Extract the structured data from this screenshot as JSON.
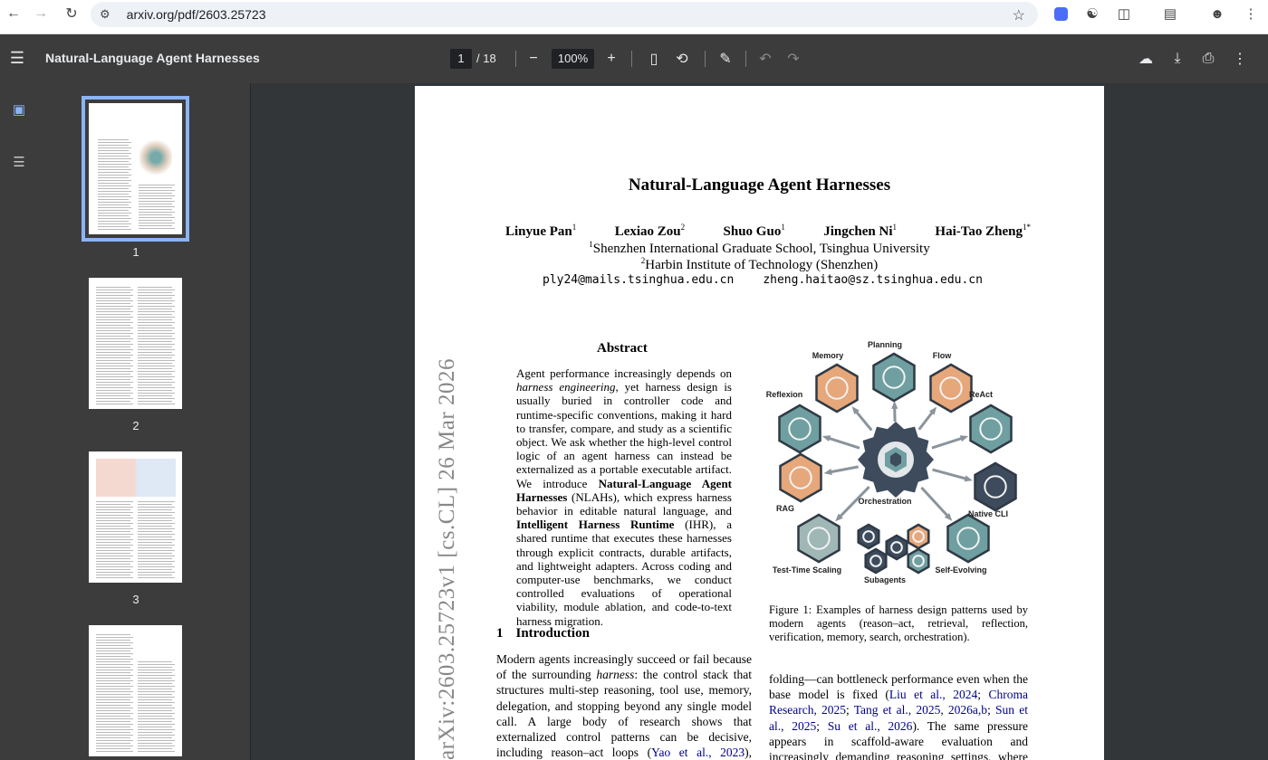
{
  "browser": {
    "url": "arxiv.org/pdf/2603.25723"
  },
  "toolbar": {
    "doc_title": "Natural-Language Agent Harnesses",
    "current_page": "1",
    "page_total": "/ 18",
    "zoom": "100%"
  },
  "sidebar": {
    "thumbnails": [
      {
        "label": "1"
      },
      {
        "label": "2"
      },
      {
        "label": "3"
      },
      {
        "label": ""
      }
    ]
  },
  "paper": {
    "title": "Natural-Language Agent Harnesses",
    "authors": [
      {
        "name": "Linyue Pan",
        "sup": "1"
      },
      {
        "name": "Lexiao Zou",
        "sup": "2"
      },
      {
        "name": "Shuo Guo",
        "sup": "1"
      },
      {
        "name": "Jingchen Ni",
        "sup": "1"
      },
      {
        "name": "Hai-Tao Zheng",
        "sup": "1*"
      }
    ],
    "affiliations": [
      {
        "sup": "1",
        "text": "Shenzhen International Graduate School, Tsinghua University"
      },
      {
        "sup": "2",
        "text": "Harbin Institute of Technology (Shenzhen)"
      }
    ],
    "emails": [
      "ply24@mails.tsinghua.edu.cn",
      "zheng.haitao@sz.tsinghua.edu.cn"
    ],
    "arxiv_stamp": "arXiv:2603.25723v1  [cs.CL]  26 Mar 2026",
    "abstract_heading": "Abstract",
    "abstract": {
      "p1": "Agent performance increasingly depends on ",
      "em1": "harness engineering",
      "p2": ", yet harness design is usually buried in controller code and runtime-specific conventions, making it hard to transfer, compare, and study as a scientific object.  We ask whether the high-level control logic of an agent harness can instead be externalized as a portable executable artifact. We introduce ",
      "b1": "Natural-Language Agent Harnesses",
      "p3": " (NLAHs), which express harness behavior in editable natural language, and ",
      "b2": "Intelligent Harness Runtime",
      "p4": " (IHR), a shared runtime that executes these harnesses through explicit contracts, durable artifacts, and lightweight adapters.  Across coding and computer-use benchmarks, we conduct controlled evaluations of operational viability, module ablation, and code-to-text harness migration."
    },
    "section1": {
      "number": "1",
      "title": "Introduction"
    },
    "intro": {
      "p1": "Modern agents increasingly succeed or fail because of the surrounding ",
      "em1": "harness",
      "p2": ": the control stack that structures multi-step reasoning, tool use, memory, delegation, and stopping beyond any single model call.  A large body of research shows that externalized control patterns can be decisive, including reason–act loops (",
      "cite1": "Yao et al., 2023",
      "p3": "), retrieval-"
    },
    "figure": {
      "labels": {
        "memory": "Memory",
        "planning": "Planning",
        "flow": "Flow",
        "reflexion": "Reflexion",
        "react": "ReAct",
        "rag": "RAG",
        "orchestration": "Orchestration",
        "native_cli": "Native CLI",
        "test_time_scaling": "Test-Time Scaling",
        "subagents": "Subagents",
        "self_evolving": "Self-Evolving"
      },
      "caption": "Figure 1: Examples of harness design patterns used by modern agents (reason–act, retrieval, reflection, verification, memory, search, orchestration)."
    },
    "right_col": {
      "p1": "folding—can bottleneck performance even when the base model is fixed (",
      "cite1": "Liu et al., 2024",
      "sep1": "; ",
      "cite2": "Chroma Research, 2025",
      "sep2": "; ",
      "cite3": "Tang et al., 2025, 2026a,b",
      "sep3": "; ",
      "cite4": "Sun et al., 2025",
      "sep4": "; ",
      "cite5": "Su et al., 2026",
      "p2": "). The same pressure appears in scaffold-aware evaluation and increasingly demanding reasoning settings, where differences"
    }
  },
  "colors": {
    "hex_teal": "#6f9fa0",
    "hex_orange": "#e6a77a",
    "hex_slate": "#3d4b5c",
    "arrow": "#8a949c",
    "link": "#00008b",
    "accent": "#8ab4f8"
  }
}
